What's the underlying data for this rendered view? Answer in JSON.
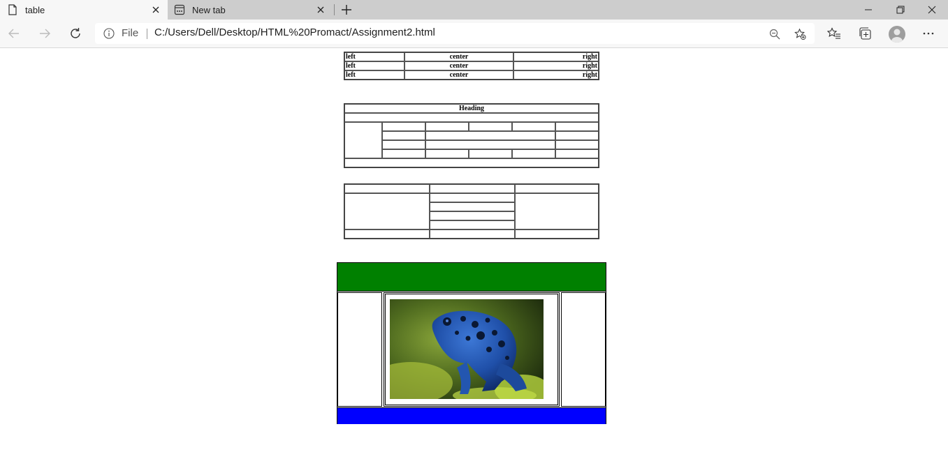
{
  "browser": {
    "tabs": [
      {
        "label": "table",
        "icon": "page-icon",
        "active": true
      },
      {
        "label": "New tab",
        "icon": "new-tab-page-icon",
        "active": false
      }
    ],
    "address": {
      "scheme_label": "File",
      "url": "C:/Users/Dell/Desktop/HTML%20Promact/Assignment2.html"
    }
  },
  "page": {
    "table1": {
      "rows": [
        [
          "left",
          "center",
          "right"
        ],
        [
          "left",
          "center",
          "right"
        ],
        [
          "left",
          "center",
          "right"
        ]
      ]
    },
    "table2": {
      "heading": "Heading"
    },
    "image_table": {
      "top_color": "#008000",
      "bottom_color": "#0000ff",
      "image": "blue-poison-dart-frog"
    }
  }
}
